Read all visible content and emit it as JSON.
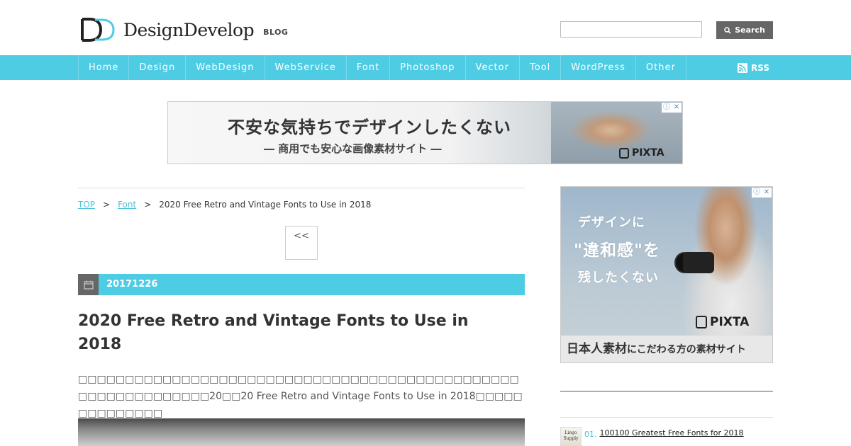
{
  "header": {
    "logo_text": "DesignDevelop",
    "logo_suffix": "BLOG",
    "search": {
      "value": "",
      "placeholder": "",
      "button_label": "Search"
    }
  },
  "nav": {
    "items": [
      "Home",
      "Design",
      "WebDesign",
      "WebService",
      "Font",
      "Photoshop",
      "Vector",
      "Tool",
      "WordPress",
      "Other"
    ],
    "rss_label": "RSS"
  },
  "ad_top": {
    "line1": "不安な気持ちでデザインしたくない",
    "line2": "― 商用でも安心な画像素材サイト ―",
    "brand": "PIXTA"
  },
  "breadcrumb": {
    "items": [
      "TOP",
      "Font",
      "2020 Free Retro and Vintage Fonts to Use in 2018"
    ],
    "separator": ">"
  },
  "pager": {
    "prev_label": "<<"
  },
  "post": {
    "date": "20171226",
    "title": "2020 Free Retro and Vintage Fonts to Use in 2018",
    "excerpt": "□□□□□□□□□□□□□□□□□□□□□□□□□□□□□□□□□□□□□□□□□□□□□□□□□□□□□□□□□□□□□20□□20 Free Retro and Vintage Fonts to Use in 2018□□□□□□□□□□□□□□"
  },
  "ad_side": {
    "line1": "デザインに",
    "line2": "\"違和感\"を",
    "line3": "残したくない",
    "brand": "PIXTA",
    "footer_bold": "日本人素材",
    "footer_rest": "にこだわる方の素材サイト"
  },
  "ranking": [
    {
      "number": "01.",
      "title": "100100 Greatest Free Fonts for 2018",
      "thumb_text": "Lingo Supply"
    }
  ],
  "colors": {
    "accent": "#4ecce4",
    "link": "#4ec1d8",
    "dark": "#666666"
  }
}
